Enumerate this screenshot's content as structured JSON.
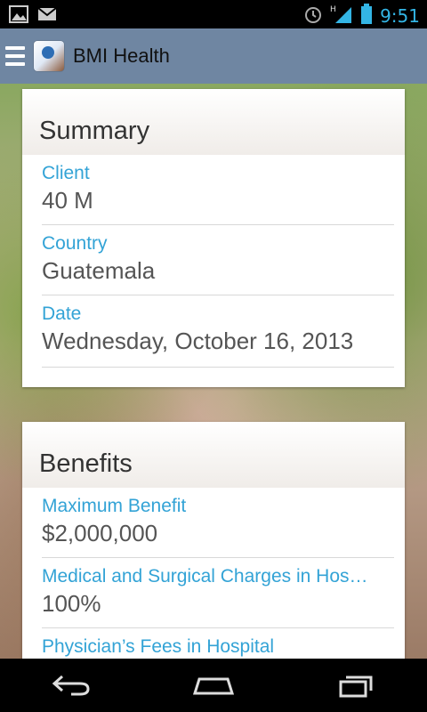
{
  "status_bar": {
    "time": "9:51",
    "icons": [
      "gallery-icon",
      "mail-icon",
      "alarm-icon",
      "signal-icon",
      "battery-icon"
    ],
    "network_label": "H"
  },
  "action_bar": {
    "title": "BMI Health",
    "menu_icon": "menu-icon",
    "app_icon": "app-logo-icon",
    "background": "#6f86a2"
  },
  "summary_card": {
    "title": "Summary",
    "fields": [
      {
        "label": "Client",
        "value": "40 M"
      },
      {
        "label": "Country",
        "value": "Guatemala"
      },
      {
        "label": "Date",
        "value": "Wednesday, October 16, 2013"
      }
    ]
  },
  "benefits_card": {
    "title": "Benefits",
    "fields": [
      {
        "label": "Maximum Benefit",
        "value": "$2,000,000"
      },
      {
        "label": "Medical and Surgical Charges in Hos…",
        "value": "100%"
      },
      {
        "label": "Physician’s Fees in Hospital",
        "value": ""
      }
    ]
  },
  "nav_bar": {
    "buttons": [
      "back-icon",
      "home-icon",
      "recent-apps-icon"
    ]
  },
  "colors": {
    "accent": "#33a3d6",
    "value_text": "#555555"
  }
}
